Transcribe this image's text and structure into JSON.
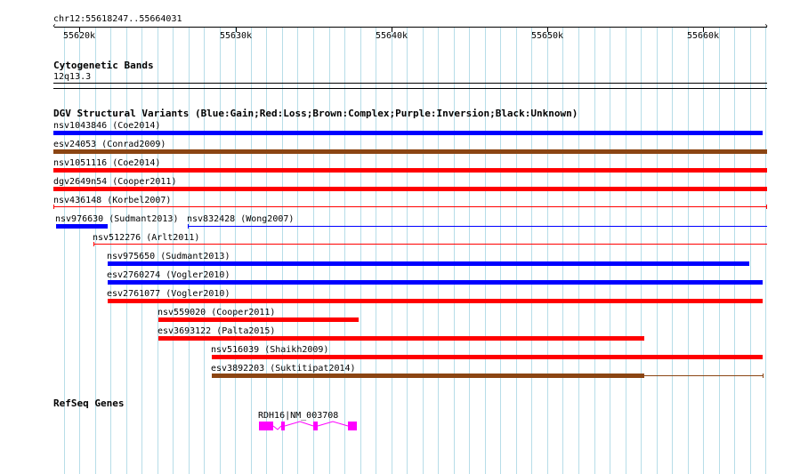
{
  "region": {
    "label": "chr12:55618247..55664031",
    "ticks": [
      "55620k",
      "55630k",
      "55640k",
      "55650k",
      "55660k"
    ]
  },
  "cytoband": {
    "title": "Cytogenetic Bands",
    "band": "12q13.3"
  },
  "dgv": {
    "title": "DGV Structural Variants (Blue:Gain;Red:Loss;Brown:Complex;Purple:Inversion;Black:Unknown)",
    "colors": {
      "gain": "#0000ff",
      "loss": "#ff0000",
      "complex": "#8b4513",
      "inversion": "#800080",
      "unknown": "#000000"
    },
    "variants": [
      {
        "label": "nsv1043846 (Coe2014)",
        "type": "gain"
      },
      {
        "label": "esv24053 (Conrad2009)",
        "type": "complex"
      },
      {
        "label": "nsv1051116 (Coe2014)",
        "type": "loss"
      },
      {
        "label": "dgv2649n54 (Cooper2011)",
        "type": "loss"
      },
      {
        "label": "nsv436148 (Korbel2007)",
        "type": "loss"
      },
      {
        "label": "nsv976630 (Sudmant2013)",
        "type": "gain"
      },
      {
        "label": "nsv832428 (Wong2007)",
        "type": "gain"
      },
      {
        "label": "nsv512276 (Arlt2011)",
        "type": "loss"
      },
      {
        "label": "nsv975650 (Sudmant2013)",
        "type": "gain"
      },
      {
        "label": "esv2760274 (Vogler2010)",
        "type": "gain"
      },
      {
        "label": "esv2761077 (Vogler2010)",
        "type": "loss"
      },
      {
        "label": "nsv559020 (Cooper2011)",
        "type": "loss"
      },
      {
        "label": "esv3693122 (Palta2015)",
        "type": "loss"
      },
      {
        "label": "nsv516039 (Shaikh2009)",
        "type": "loss"
      },
      {
        "label": "esv3892203 (Suktitipat2014)",
        "type": "complex"
      }
    ]
  },
  "refseq": {
    "title": "RefSeq Genes",
    "gene_label": "RDH16|NM_003708",
    "color": "#ff00ff"
  }
}
